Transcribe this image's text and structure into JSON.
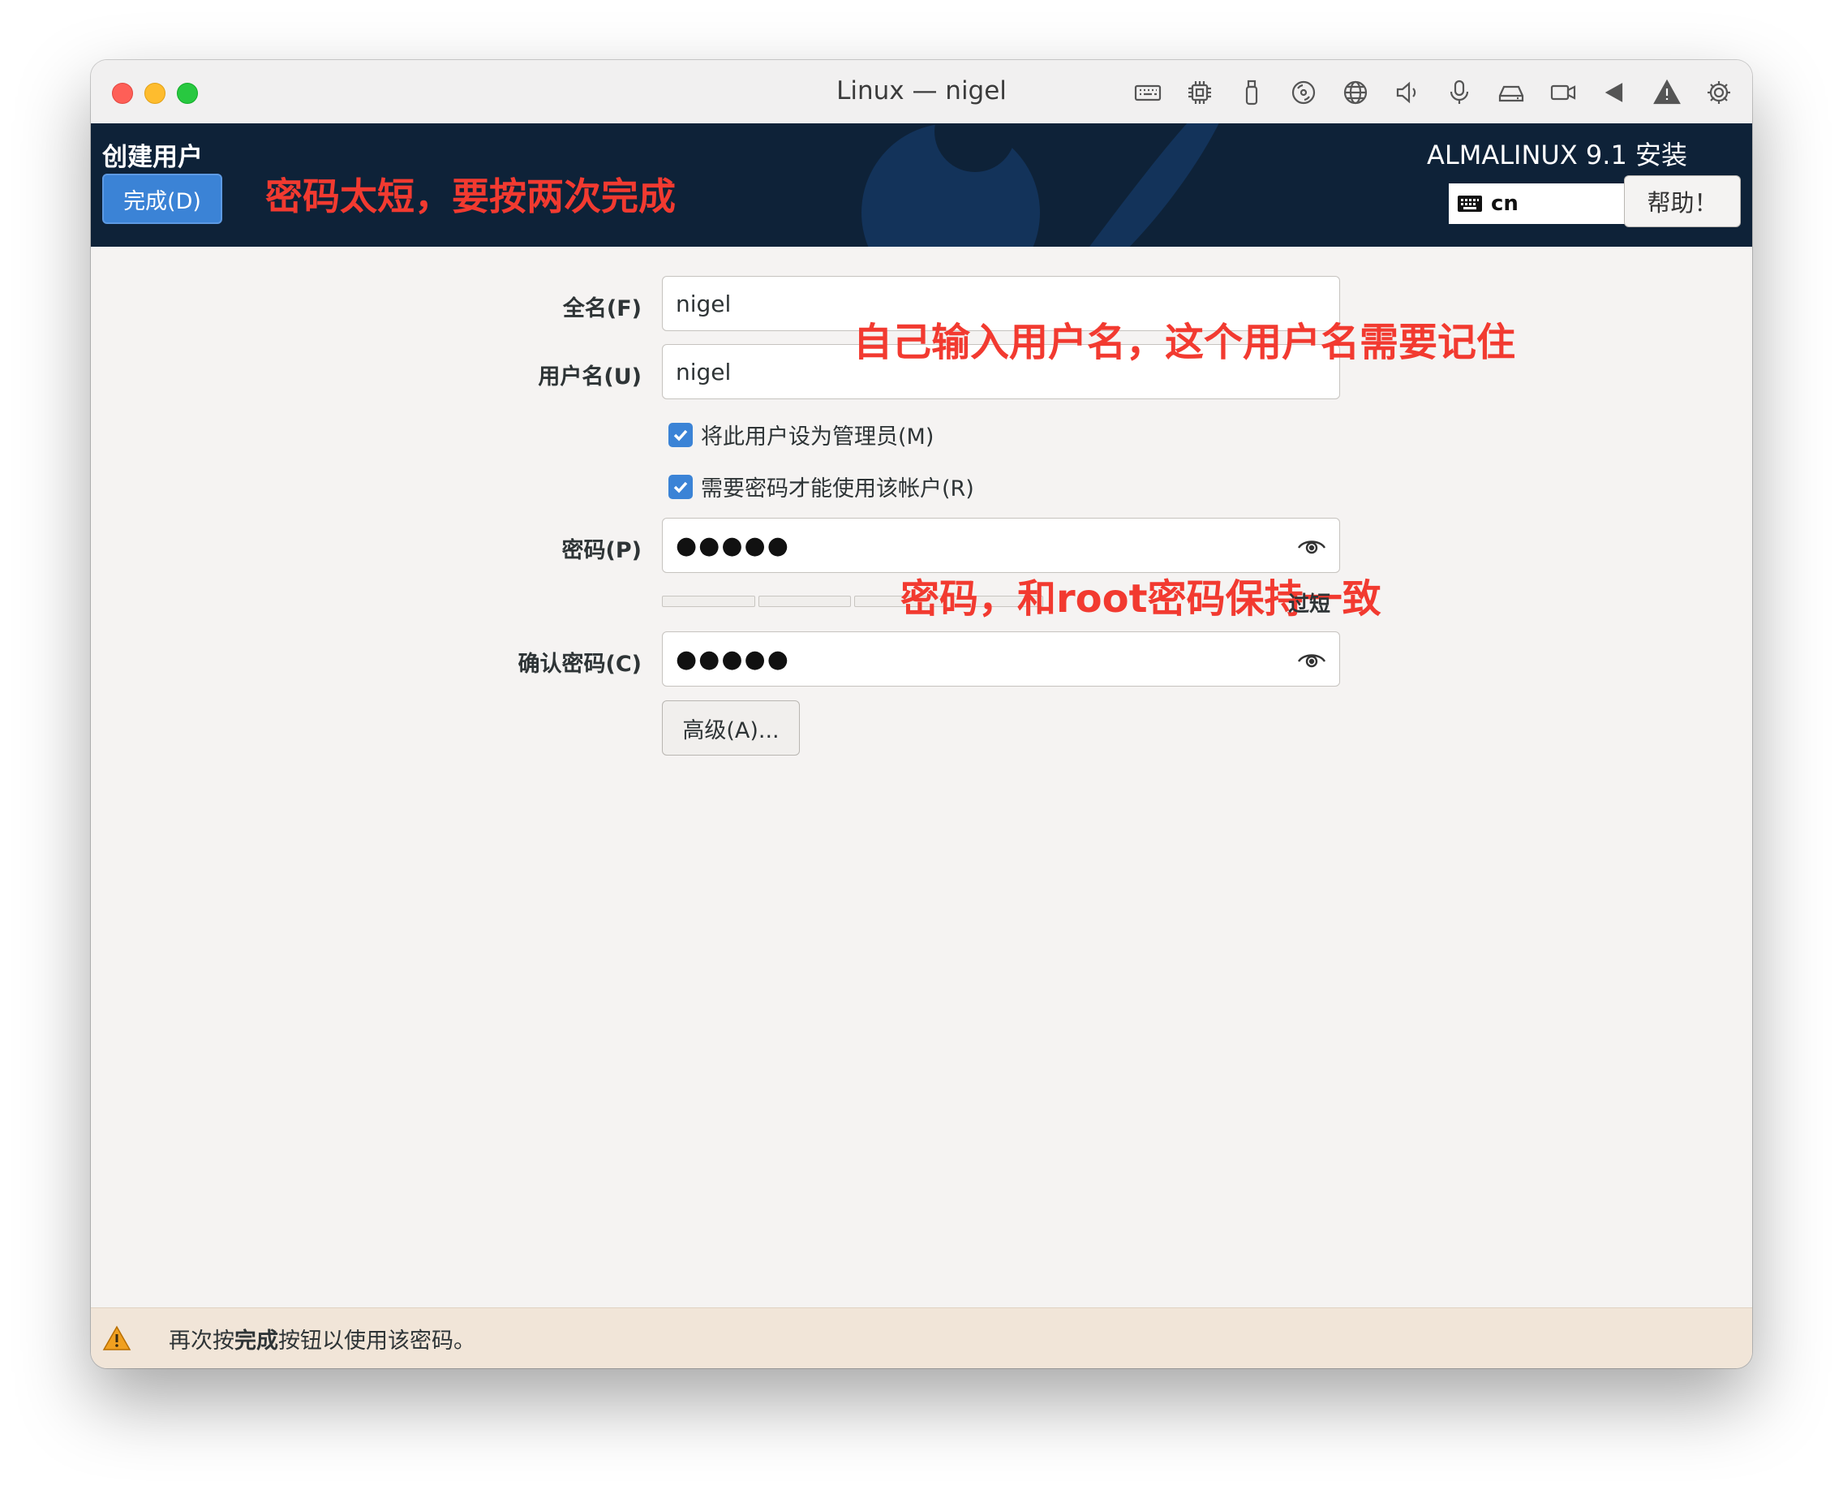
{
  "window": {
    "title": "Linux — nigel"
  },
  "toolbar": {
    "icons": [
      "keyboard-icon",
      "cpu-icon",
      "usb-icon",
      "disc-icon",
      "network-icon",
      "speaker-icon",
      "microphone-icon",
      "disk-icon",
      "camera-icon",
      "back-arrow-icon",
      "warning-icon",
      "settings-icon"
    ]
  },
  "header": {
    "spoke_title": "创建用户",
    "done_label": "完成(D)",
    "annotation": "密码太短，要按两次完成",
    "product": "ALMALINUX 9.1 安装",
    "keyboard_layout": "cn",
    "help_label": "帮助！",
    "background_color": "#0e2238",
    "accent_color": "#3b83d6",
    "annotation_color": "#f23a30"
  },
  "form": {
    "fullname_label": "全名(F)",
    "fullname_value": "nigel",
    "username_label": "用户名(U)",
    "username_value": "nigel",
    "admin_checkbox_label": "将此用户设为管理员(M)",
    "admin_checked": true,
    "require_password_label": "需要密码才能使用该帐户(R)",
    "require_password_checked": true,
    "password_label": "密码(P)",
    "password_value": "●●●●●",
    "strength_text": "过短",
    "strength_level": 0,
    "confirm_label": "确认密码(C)",
    "confirm_value": "●●●●●",
    "advanced_label": "高级(A)...",
    "annotation_username": "自己输入用户名，这个用户名需要记住",
    "annotation_password": "密码，和root密码保持一致"
  },
  "warning": {
    "prefix": "再次按",
    "bold": "完成",
    "suffix": "按钮以使用该密码。"
  }
}
